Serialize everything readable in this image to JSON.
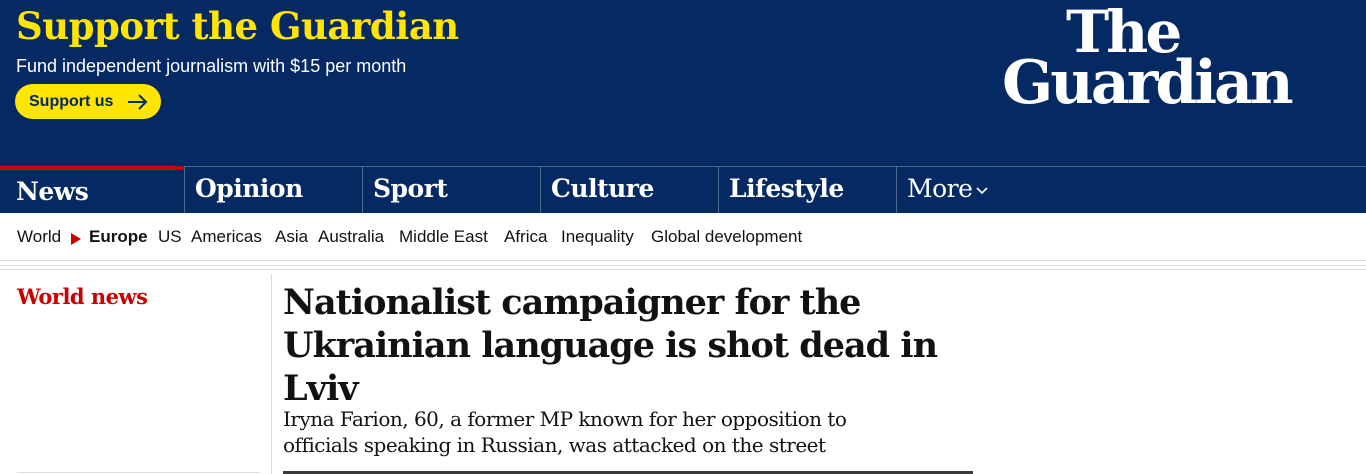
{
  "support": {
    "title": "Support the Guardian",
    "subtitle": "Fund independent journalism with $15 per month",
    "button_label": "Support us",
    "button_icon": "arrow-right-icon"
  },
  "logo": {
    "line1": "The",
    "line2": "Guardian"
  },
  "pillars": [
    {
      "label": "News",
      "active": true
    },
    {
      "label": "Opinion"
    },
    {
      "label": "Sport"
    },
    {
      "label": "Culture"
    },
    {
      "label": "Lifestyle"
    },
    {
      "label": "More",
      "icon": "chevron-down-icon"
    }
  ],
  "subnav": {
    "items": [
      "World",
      "Europe",
      "US",
      "Americas",
      "Asia",
      "Australia",
      "Middle East",
      "Africa",
      "Inequality",
      "Global development"
    ],
    "current": "Europe"
  },
  "article": {
    "section": "World news",
    "headline": "Nationalist campaigner for the Ukrainian language is shot dead in Lviv",
    "standfirst": "Iryna Farion, 60, a former MP known for her opposition to officials speaking in Russian, was attacked on the street"
  },
  "colors": {
    "brand_blue": "#052962",
    "support_yellow": "#ffe500",
    "news_red": "#c70000"
  }
}
